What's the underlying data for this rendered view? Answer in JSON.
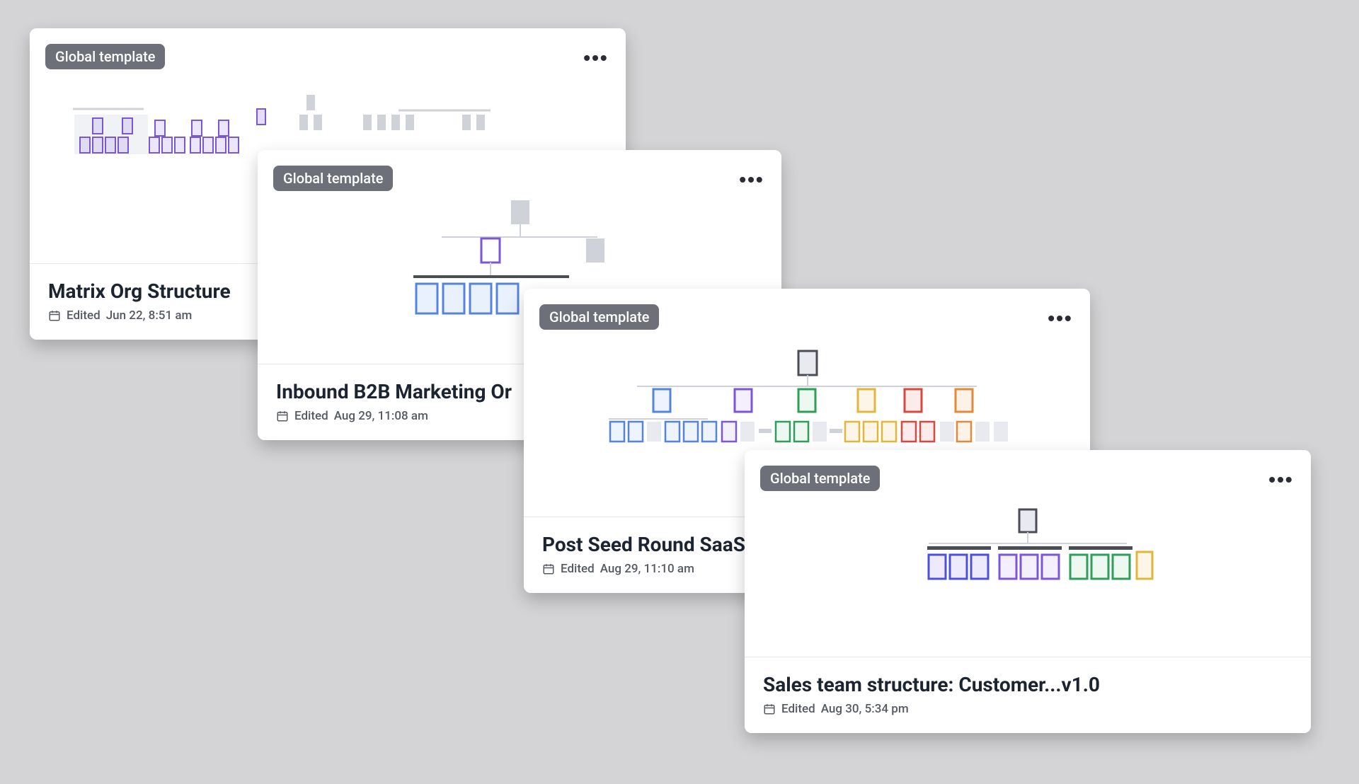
{
  "badge_label": "Global template",
  "edited_prefix": "Edited",
  "cards": [
    {
      "title": "Matrix Org Structure",
      "edited": "Jun 22, 8:51 am"
    },
    {
      "title": "Inbound B2B Marketing Or",
      "edited": "Aug 29, 11:08 am"
    },
    {
      "title": "Post Seed Round SaaS",
      "edited": "Aug 29, 11:10 am"
    },
    {
      "title": "Sales team structure: Customer...v1.0",
      "edited": "Aug 30, 5:34 pm"
    }
  ],
  "colors": {
    "purple": "#7b57d6",
    "blue": "#5584e0",
    "green": "#2f9e5a",
    "orange": "#e08a3b",
    "red": "#d6493e",
    "yellow": "#e0b63b",
    "gray": "#b8bcc4",
    "dark": "#4a4d55"
  }
}
